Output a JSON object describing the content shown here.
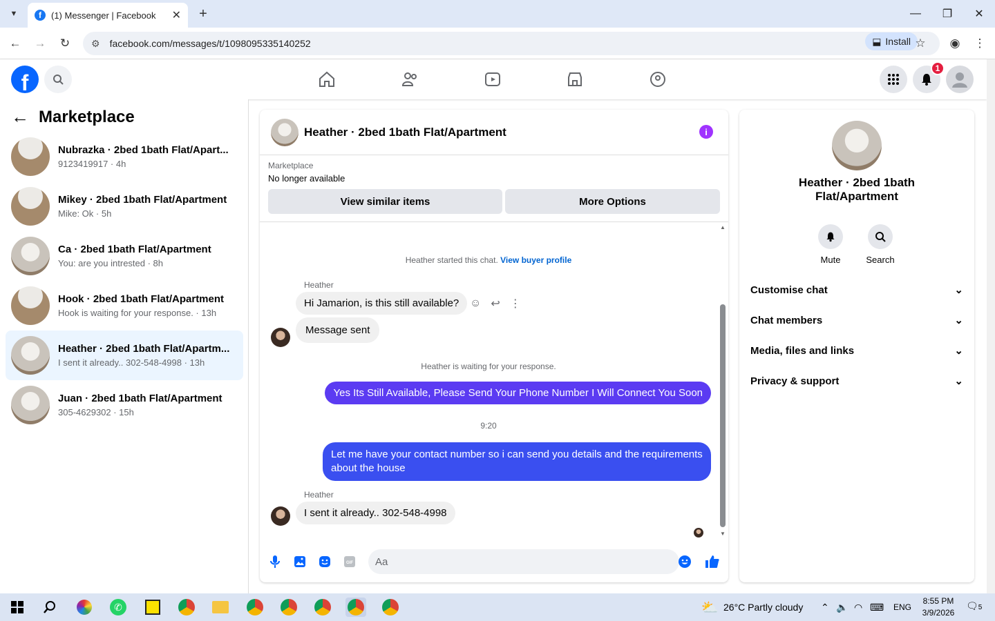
{
  "browser": {
    "tab_title": "(1) Messenger | Facebook",
    "url": "facebook.com/messages/t/1098095335140252",
    "install_label": "Install"
  },
  "sidebar": {
    "title": "Marketplace",
    "items": [
      {
        "title": "Nubrazka · 2bed 1bath Flat/Apart...",
        "sub": "9123419917 · 4h"
      },
      {
        "title": "Mikey · 2bed 1bath Flat/Apartment",
        "sub": "Mike: Ok · 5h"
      },
      {
        "title": "Ca · 2bed 1bath Flat/Apartment",
        "sub": "You: are you intrested · 8h"
      },
      {
        "title": "Hook · 2bed 1bath Flat/Apartment",
        "sub": "Hook is waiting for your response. · 13h"
      },
      {
        "title": "Heather · 2bed 1bath Flat/Apartm...",
        "sub": "I sent it already.. 302-548-4998 · 13h"
      },
      {
        "title": "Juan · 2bed 1bath Flat/Apartment",
        "sub": "305-4629302 · 15h"
      }
    ]
  },
  "chat": {
    "title": "Heather · 2bed 1bath Flat/Apartment",
    "marketplace_label": "Marketplace",
    "status": "No longer available",
    "view_similar": "View similar items",
    "more_options": "More Options",
    "started": "Heather started this chat.",
    "view_buyer": "View buyer profile",
    "sender1": "Heather",
    "msg1": "Hi Jamarion, is this still available?",
    "msg2": "Message sent",
    "waiting": "Heather is waiting for your response.",
    "out1": "Yes Its Still Available, Please Send Your Phone Number I Will Connect You Soon",
    "time": "9:20",
    "out2": "Let me have your contact number so i can send you details and the requirements about the house",
    "sender2": "Heather",
    "msg3": "I sent it already.. 302-548-4998",
    "input_placeholder": "Aa"
  },
  "details": {
    "name": "Heather · 2bed 1bath Flat/Apartment",
    "mute": "Mute",
    "search": "Search",
    "sections": [
      "Customise chat",
      "Chat members",
      "Media, files and links",
      "Privacy & support"
    ]
  },
  "notifications": {
    "count": "1"
  },
  "taskbar": {
    "weather": "26°C  Partly cloudy",
    "lang": "ENG",
    "time": "8:55 PM",
    "date": "3/9/2026",
    "notif": "5"
  },
  "colors": {
    "out_bubble_1": "#5b3bf2",
    "out_bubble_2": "#3a4ff0",
    "fb_blue": "#0866ff"
  }
}
